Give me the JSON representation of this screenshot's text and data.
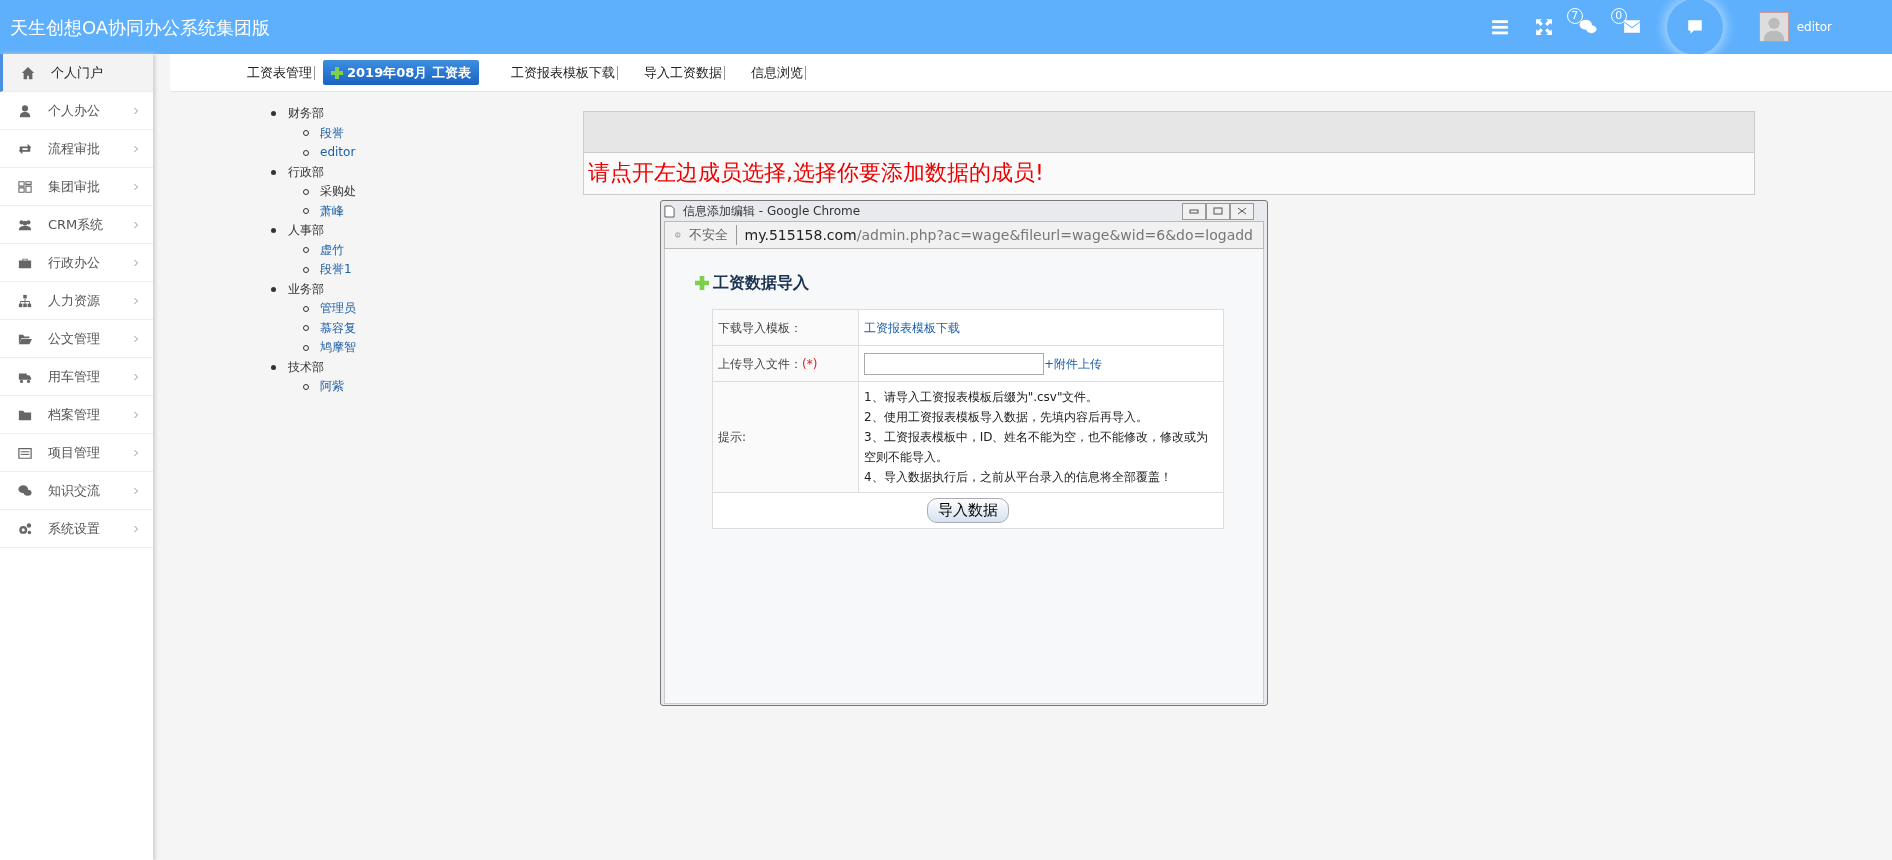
{
  "header": {
    "title": "天生创想OA协同办公系统集团版",
    "counters": [
      {
        "kind": "chat",
        "count": "7"
      },
      {
        "kind": "mail",
        "count": "0"
      }
    ],
    "user": "editor"
  },
  "sidebar": {
    "items": [
      {
        "label": "个人门户",
        "selected": true,
        "expandable": false
      },
      {
        "label": "个人办公",
        "selected": false,
        "expandable": true
      },
      {
        "label": "流程审批",
        "selected": false,
        "expandable": true
      },
      {
        "label": "集团审批",
        "selected": false,
        "expandable": true
      },
      {
        "label": "CRM系统",
        "selected": false,
        "expandable": true
      },
      {
        "label": "行政办公",
        "selected": false,
        "expandable": true
      },
      {
        "label": "人力资源",
        "selected": false,
        "expandable": true
      },
      {
        "label": "公文管理",
        "selected": false,
        "expandable": true
      },
      {
        "label": "用车管理",
        "selected": false,
        "expandable": true
      },
      {
        "label": "档案管理",
        "selected": false,
        "expandable": true
      },
      {
        "label": "项目管理",
        "selected": false,
        "expandable": true
      },
      {
        "label": "知识交流",
        "selected": false,
        "expandable": true
      },
      {
        "label": "系统设置",
        "selected": false,
        "expandable": true
      }
    ]
  },
  "tabs": [
    {
      "label": "工资表管理",
      "selected": false
    },
    {
      "label": "2019年08月 工资表",
      "selected": true
    },
    {
      "label": "工资报表模板下载",
      "selected": false
    },
    {
      "label": "导入工资数据",
      "selected": false
    },
    {
      "label": "信息浏览",
      "selected": false
    }
  ],
  "tree": [
    {
      "label": "财务部",
      "children": [
        {
          "label": "段誉",
          "kind": "link"
        },
        {
          "label": "editor",
          "kind": "link"
        }
      ]
    },
    {
      "label": "行政部",
      "children": [
        {
          "label": "采购处",
          "kind": "text"
        },
        {
          "label": "萧峰",
          "kind": "link"
        }
      ]
    },
    {
      "label": "人事部",
      "children": [
        {
          "label": "虚竹",
          "kind": "link"
        },
        {
          "label": "段誉1",
          "kind": "link"
        }
      ]
    },
    {
      "label": "业务部",
      "children": [
        {
          "label": "管理员",
          "kind": "link"
        },
        {
          "label": "慕容复",
          "kind": "link"
        },
        {
          "label": "鸠摩智",
          "kind": "link"
        }
      ]
    },
    {
      "label": "技术部",
      "children": [
        {
          "label": "阿紫",
          "kind": "link"
        }
      ]
    }
  ],
  "notice": "请点开左边成员选择,选择你要添加数据的成员!",
  "dialog": {
    "title": "信息添加编辑 - Google Chrome",
    "security": "不安全",
    "url_host": "my.515158.com",
    "url_path": "/admin.php?ac=wage&fileurl=wage&wid=6&do=logadd",
    "heading": "工资数据导入",
    "rows": [
      {
        "label": "下载导入模板：",
        "link": "工资报表模板下载"
      },
      {
        "label": "上传导入文件：",
        "required": "(*)",
        "upload": "+附件上传"
      },
      {
        "label": "提示:",
        "tips": [
          "1、请导入工资报表模板后缀为\".csv\"文件。",
          "2、使用工资报表模板导入数据，先填内容后再导入。",
          "3、工资报表模板中，ID、姓名不能为空，也不能修改，修改或为空则不能导入。",
          "4、导入数据执行后，之前从平台录入的信息将全部覆盖！"
        ]
      }
    ],
    "submit": "导入数据"
  }
}
